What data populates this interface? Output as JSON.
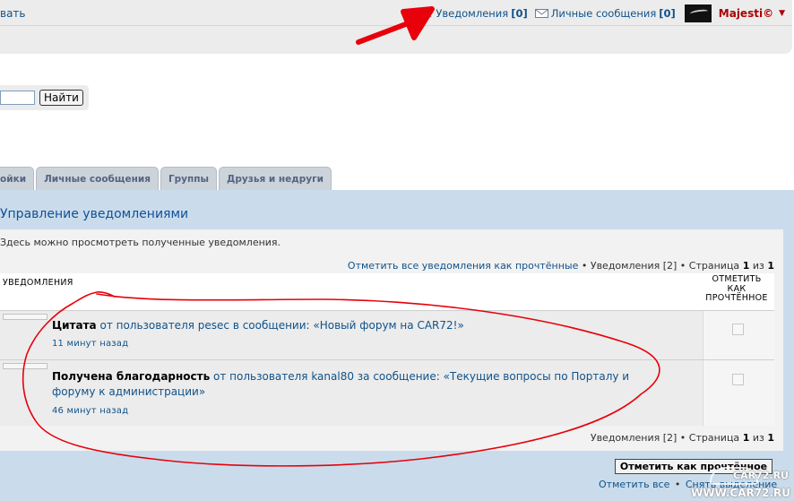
{
  "navbar": {
    "left_link": "вать",
    "notifications_label": "Уведомления",
    "notifications_count": "[0]",
    "messages_label": "Личные сообщения",
    "messages_count": "[0]",
    "username": "Majesti©",
    "username_caret": "▼"
  },
  "search": {
    "button_label": "Найти",
    "input_value": ""
  },
  "tabs": [
    {
      "label": "ойки"
    },
    {
      "label": "Личные сообщения"
    },
    {
      "label": "Группы"
    },
    {
      "label": "Друзья и недруги"
    }
  ],
  "panel": {
    "title": "Управление уведомлениями",
    "intro": "Здесь можно просмотреть полученные уведомления.",
    "pagination_top": {
      "mark_all_link": "Отметить все уведомления как прочтённые",
      "sep": "•",
      "notif_label": "Уведомления [2]",
      "page_label": "Страница",
      "page_current": "1",
      "page_of": "из",
      "page_total": "1"
    },
    "pagination_bottom": {
      "notif_label": "Уведомления [2]",
      "sep": "•",
      "page_label": "Страница",
      "page_current": "1",
      "page_of": "из",
      "page_total": "1"
    },
    "table": {
      "col_notifications": "УВЕДОМЛЕНИЯ",
      "col_mark_lines": [
        "ОТМЕТИТЬ",
        "КАК",
        "ПРОЧТЁННОЕ"
      ],
      "rows": [
        {
          "type": "Цитата",
          "text": " от пользователя pesec в сообщении: «Новый форум на CAR72!»",
          "time": "11 минут назад"
        },
        {
          "type": "Получена благодарность",
          "text": " от пользователя kanal80 за сообщение: «Текущие вопросы по Порталу и форуму к администрации»",
          "time": "46 минут назад"
        }
      ]
    },
    "mark_button": "Отметить как прочтённое",
    "bottom_links": {
      "mark_all": "Отметить все",
      "sep": "•",
      "unmark": "Снять выделение"
    }
  },
  "watermark": {
    "line1": "CAR72.RU",
    "line2": "WWW.CAR72.RU"
  },
  "colors": {
    "link": "#105289",
    "panel_bg": "#cadceb",
    "annotation_red": "#e8000b",
    "username": "#aa0000"
  }
}
